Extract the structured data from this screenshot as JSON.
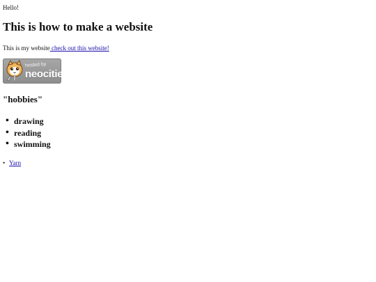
{
  "greeting": "Hello!",
  "title": "This is how to make a website",
  "intro": {
    "text": "This is my website",
    "link_text": " check out this website!"
  },
  "badge": {
    "line1": "hosted by",
    "line2": "neocities",
    "icon": "neocities-cat-logo"
  },
  "hobbies_heading": "\"hobbies\"",
  "hobbies": [
    "drawing",
    "reading",
    "swimming"
  ],
  "links": [
    "Yarn"
  ],
  "colors": {
    "link": "#1a0dab",
    "badge_bg": "#999999"
  }
}
